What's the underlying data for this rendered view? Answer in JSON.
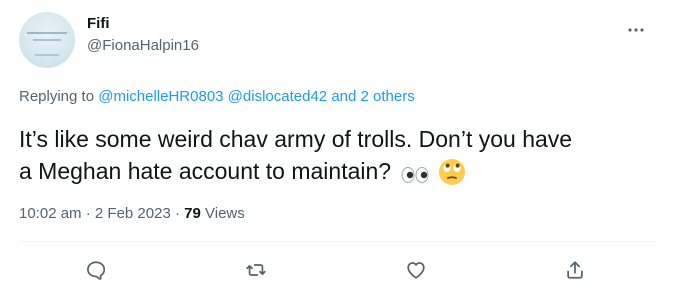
{
  "author": {
    "display_name": "Fifi",
    "handle": "@FionaHalpin16"
  },
  "more_icon": "more-horizontal-icon",
  "replying": {
    "prefix": "Replying to",
    "mention_1": "@michelleHR0803",
    "mention_2": "@dislocated42",
    "others": "and 2 others"
  },
  "tweet": {
    "text_line_1": "It’s like some weird chav army of trolls. Don’t you have",
    "text_line_2": "a Meghan hate account to maintain?",
    "emojis": [
      "eyes-emoji",
      "face-with-rolling-eyes-emoji"
    ]
  },
  "meta": {
    "time": "10:02 am",
    "date": "2 Feb 2023",
    "views_count": "79",
    "views_label": "Views"
  },
  "actions": [
    "reply-icon",
    "retweet-icon",
    "like-icon",
    "share-icon"
  ],
  "colors": {
    "link": "#1d9bf0",
    "secondary_text": "#536471",
    "primary_text": "#0f1419"
  }
}
